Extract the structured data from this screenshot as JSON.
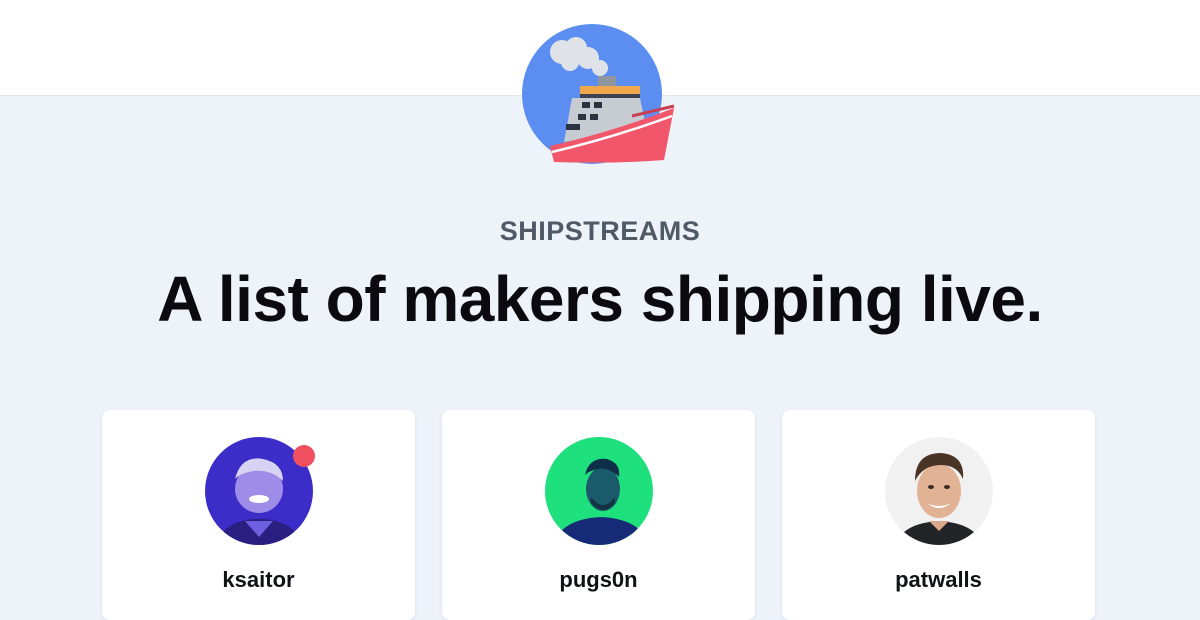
{
  "brand": "SHIPSTREAMS",
  "headline": "A list of makers shipping live.",
  "logo_icon": "ship-icon",
  "colors": {
    "logo_circle": "#5b8ef0",
    "hull": "#f1566a",
    "page_bg": "#eef2f9",
    "live_dot": "#f0505f"
  },
  "makers": [
    {
      "username": "ksaitor",
      "live": true,
      "avatar_icon": "avatar-photo"
    },
    {
      "username": "pugs0n",
      "live": false,
      "avatar_icon": "avatar-photo"
    },
    {
      "username": "patwalls",
      "live": false,
      "avatar_icon": "avatar-photo"
    }
  ]
}
